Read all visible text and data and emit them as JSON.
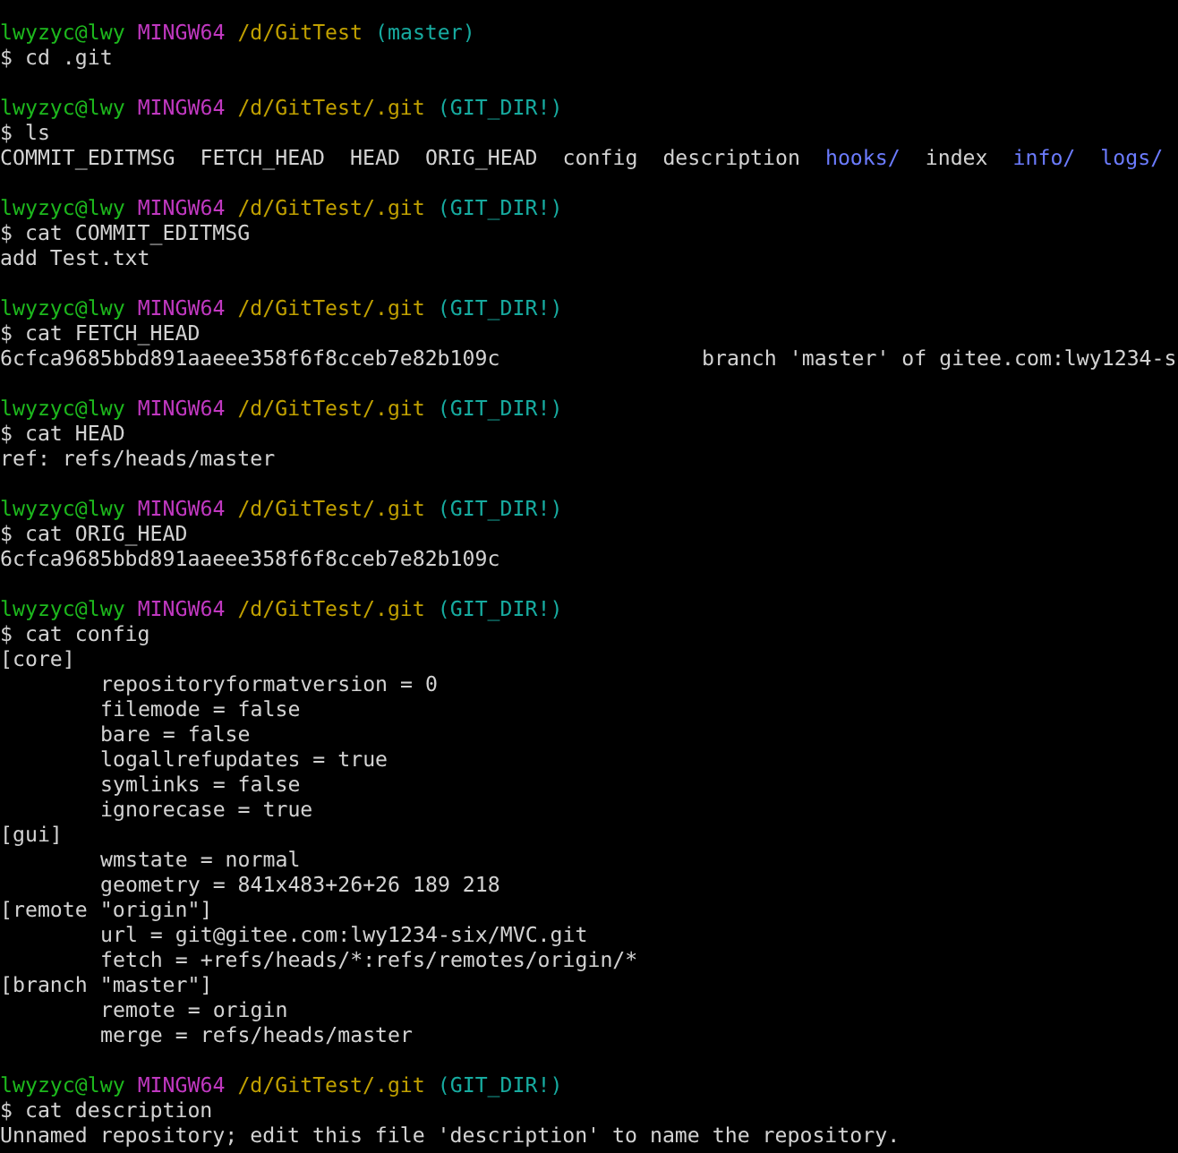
{
  "terminal": {
    "blocks": [
      {
        "prompt": {
          "user": "lwyzyc@lwy",
          "system": "MINGW64",
          "path": "/d/GitTest",
          "branch": "(master)"
        },
        "command": "$ cd .git"
      },
      {
        "prompt": {
          "user": "lwyzyc@lwy",
          "system": "MINGW64",
          "path": "/d/GitTest/.git",
          "branch": "(GIT_DIR!)"
        },
        "command": "$ ls",
        "output": [
          {
            "kind": "listing",
            "entries": [
              {
                "name": "COMMIT_EDITMSG",
                "directory": false
              },
              {
                "name": "FETCH_HEAD",
                "directory": false
              },
              {
                "name": "HEAD",
                "directory": false
              },
              {
                "name": "ORIG_HEAD",
                "directory": false
              },
              {
                "name": "config",
                "directory": false
              },
              {
                "name": "description",
                "directory": false
              },
              {
                "name": "hooks/",
                "directory": true
              },
              {
                "name": "index",
                "directory": false
              },
              {
                "name": "info/",
                "directory": true
              },
              {
                "name": "logs/",
                "directory": true
              }
            ]
          }
        ]
      },
      {
        "prompt": {
          "user": "lwyzyc@lwy",
          "system": "MINGW64",
          "path": "/d/GitTest/.git",
          "branch": "(GIT_DIR!)"
        },
        "command": "$ cat COMMIT_EDITMSG",
        "output": [
          {
            "kind": "text",
            "text": "add Test.txt"
          }
        ]
      },
      {
        "prompt": {
          "user": "lwyzyc@lwy",
          "system": "MINGW64",
          "path": "/d/GitTest/.git",
          "branch": "(GIT_DIR!)"
        },
        "command": "$ cat FETCH_HEAD",
        "output": [
          {
            "kind": "columns",
            "cells": [
              "6cfca9685bbd891aaeee358f6f8cceb7e82b109c",
              "branch 'master' of gitee.com:lwy1234-s"
            ]
          }
        ]
      },
      {
        "prompt": {
          "user": "lwyzyc@lwy",
          "system": "MINGW64",
          "path": "/d/GitTest/.git",
          "branch": "(GIT_DIR!)"
        },
        "command": "$ cat HEAD",
        "output": [
          {
            "kind": "text",
            "text": "ref: refs/heads/master"
          }
        ]
      },
      {
        "prompt": {
          "user": "lwyzyc@lwy",
          "system": "MINGW64",
          "path": "/d/GitTest/.git",
          "branch": "(GIT_DIR!)"
        },
        "command": "$ cat ORIG_HEAD",
        "output": [
          {
            "kind": "text",
            "text": "6cfca9685bbd891aaeee358f6f8cceb7e82b109c"
          }
        ]
      },
      {
        "prompt": {
          "user": "lwyzyc@lwy",
          "system": "MINGW64",
          "path": "/d/GitTest/.git",
          "branch": "(GIT_DIR!)"
        },
        "command": "$ cat config",
        "output": [
          {
            "kind": "section",
            "header": "[core]",
            "children": [
              "repositoryformatversion = 0",
              "filemode = false",
              "bare = false",
              "logallrefupdates = true",
              "symlinks = false",
              "ignorecase = true"
            ]
          },
          {
            "kind": "section",
            "header": "[gui]",
            "children": [
              "wmstate = normal",
              "geometry = 841x483+26+26 189 218"
            ]
          },
          {
            "kind": "section",
            "header": "[remote \"origin\"]",
            "children": [
              "url = git@gitee.com:lwy1234-six/MVC.git",
              "fetch = +refs/heads/*:refs/remotes/origin/*"
            ]
          },
          {
            "kind": "section",
            "header": "[branch \"master\"]",
            "children": [
              "remote = origin",
              "merge = refs/heads/master"
            ]
          }
        ]
      },
      {
        "prompt": {
          "user": "lwyzyc@lwy",
          "system": "MINGW64",
          "path": "/d/GitTest/.git",
          "branch": "(GIT_DIR!)"
        },
        "command": "$ cat description",
        "output": [
          {
            "kind": "text",
            "text": "Unnamed repository; edit this file 'description' to name the repository."
          }
        ]
      }
    ]
  }
}
